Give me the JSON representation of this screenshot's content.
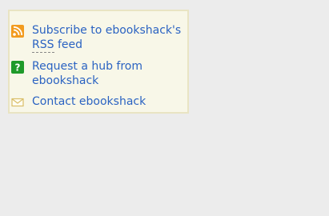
{
  "links": {
    "rss": {
      "label_line1": "Subscribe to ebookshack's",
      "label_rss": "RSS",
      "label_feed": "feed",
      "icon": "rss-icon"
    },
    "hub": {
      "label_line1": "Request a hub from",
      "label_line2": "ebookshack",
      "icon": "help-icon"
    },
    "contact": {
      "label": "Contact ebookshack",
      "icon": "envelope-icon"
    }
  },
  "colors": {
    "link": "#2b63c2",
    "panel_bg": "#f8f7e8",
    "panel_border": "#e9e4c3",
    "page_bg": "#ececec",
    "rss_orange": "#f29b1f",
    "help_green": "#1f9a2a",
    "envelope": "#d9be68"
  }
}
